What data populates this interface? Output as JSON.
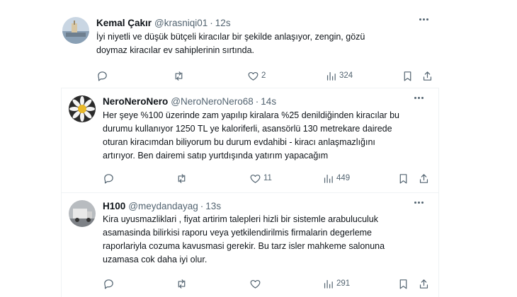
{
  "tweets": [
    {
      "name": "Kemal Çakır",
      "handle": "@krasniqi01",
      "sep": "·",
      "time": "12s",
      "lines": [
        "İyi niyetli ve düşük bütçeli kiracılar bir şekilde anlaşıyor, zengin, gözü",
        "doymaz kiracılar ev sahiplerinin sırtında."
      ],
      "replies": "",
      "retweets": "",
      "likes": "2",
      "views": "324"
    },
    {
      "name": "NeroNeroNero",
      "handle": "@NeroNeroNero68",
      "sep": "·",
      "time": "14s",
      "lines": [
        "Her şeye %100 üzerinde zam yapılıp kiralara  %25 denildiğinden kiracılar bu",
        "durumu kullanıyor 1250 TL ye kaloriferli, asansörlü 130 metrekare dairede",
        "oturan kiracımdan biliyorum bu durum evdahibi - kiracı anlaşmazlığını",
        "artırıyor. Ben dairemi satıp yurtdışında yatırım yapacağım"
      ],
      "replies": "",
      "retweets": "",
      "likes": "11",
      "views": "449"
    },
    {
      "name": "H100",
      "handle": "@meydandayag",
      "sep": "·",
      "time": "13s",
      "lines": [
        "Kira uyusmazliklari  , fiyat artirim talepleri hizli bir sistemle arabuluculuk",
        "asamasinda bilirkisi raporu veya yetkilendirilmis firmalarin degerleme",
        "raporlariyla cozuma kavusmasi gerekir. Bu tarz isler mahkeme salonuna",
        "uzamasa cok daha iyi olur."
      ],
      "replies": "",
      "retweets": "",
      "likes": "",
      "views": "291"
    }
  ],
  "icons": {
    "reply": "reply-icon",
    "retweet": "retweet-icon",
    "like": "heart-icon",
    "views": "views-icon",
    "bookmark": "bookmark-icon",
    "share": "share-icon",
    "more": "more-icon"
  },
  "colors": {
    "text": "#0f1419",
    "secondary": "#536471",
    "border": "#eff3f4"
  }
}
